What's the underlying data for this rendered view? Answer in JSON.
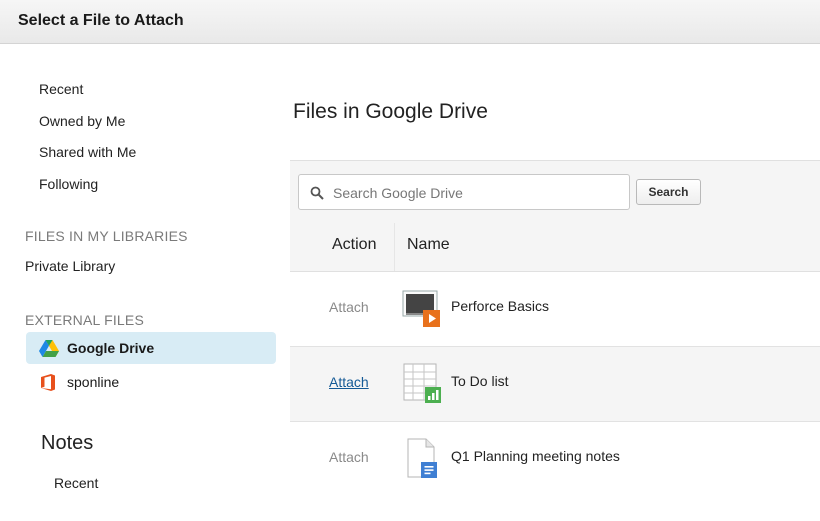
{
  "dialog": {
    "title": "Select a File to Attach"
  },
  "sidebar": {
    "nav": [
      "Recent",
      "Owned by Me",
      "Shared with Me",
      "Following"
    ],
    "libraries_heading": "FILES IN MY LIBRARIES",
    "libraries": [
      "Private Library"
    ],
    "external_heading": "EXTERNAL FILES",
    "external": [
      {
        "label": "Google Drive",
        "icon": "google-drive-icon",
        "selected": true
      },
      {
        "label": "sponline",
        "icon": "office-icon",
        "selected": false
      }
    ],
    "notes_heading": "Notes",
    "notes_items": [
      "Recent"
    ]
  },
  "main": {
    "title": "Files in Google Drive",
    "search": {
      "placeholder": "Search Google Drive",
      "value": "",
      "button": "Search"
    },
    "columns": {
      "action": "Action",
      "name": "Name"
    },
    "rows": [
      {
        "action": "Attach",
        "name": "Perforce Basics",
        "icon": "presentation-file-icon",
        "hover": false
      },
      {
        "action": "Attach",
        "name": "To Do list",
        "icon": "spreadsheet-file-icon",
        "hover": true
      },
      {
        "action": "Attach",
        "name": "Q1 Planning meeting notes",
        "icon": "document-file-icon",
        "hover": false
      }
    ]
  },
  "colors": {
    "selected_bg": "#d8ecf5",
    "link": "#155a96",
    "panel_bg": "#f5f5f5",
    "slides_orange": "#e8711c",
    "sheets_green": "#4caf50",
    "docs_blue": "#3f7fd3"
  }
}
